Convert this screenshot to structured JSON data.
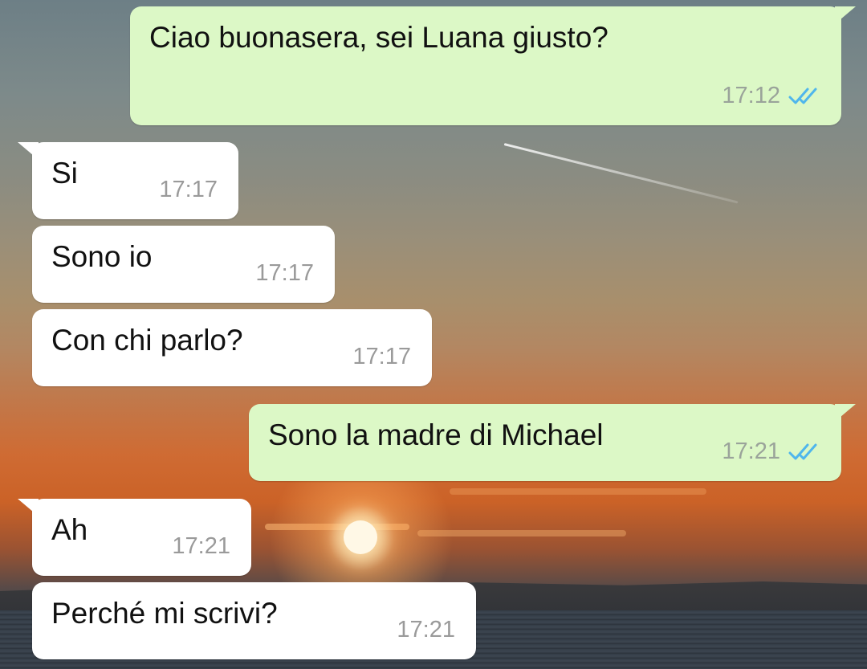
{
  "messages": [
    {
      "direction": "outgoing",
      "text": "Ciao buonasera, sei Luana giusto?",
      "time": "17:12",
      "status": "read"
    },
    {
      "direction": "incoming",
      "text": "Si",
      "time": "17:17"
    },
    {
      "direction": "incoming",
      "text": "Sono io",
      "time": "17:17"
    },
    {
      "direction": "incoming",
      "text": "Con chi parlo?",
      "time": "17:17"
    },
    {
      "direction": "outgoing",
      "text": "Sono la madre di Michael",
      "time": "17:21",
      "status": "read"
    },
    {
      "direction": "incoming",
      "text": "Ah",
      "time": "17:21"
    },
    {
      "direction": "incoming",
      "text": "Perché mi scrivi?",
      "time": "17:21"
    }
  ],
  "icons": {
    "read_receipt": "double-check-icon"
  },
  "colors": {
    "outgoing_bubble": "#dcf8c6",
    "incoming_bubble": "#ffffff",
    "read_tick": "#4fb6ec",
    "timestamp": "#9aa39a"
  }
}
